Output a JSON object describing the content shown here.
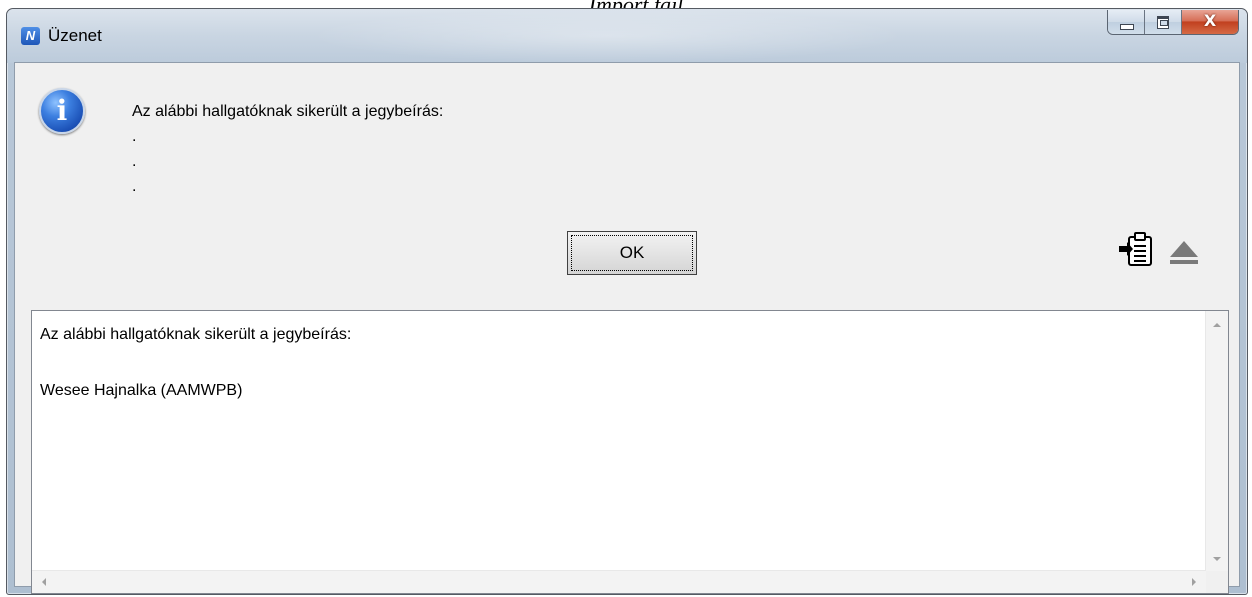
{
  "page_caption": "Import fájl",
  "window": {
    "title": "Üzenet",
    "app_icon_letter": "N",
    "close_glyph": "X"
  },
  "message": {
    "icon_letter": "i",
    "lines": [
      "Az alábbi hallgatóknak sikerült a jegybeírás:",
      ".",
      ".",
      "."
    ]
  },
  "ok_button": {
    "label": "OK"
  },
  "icons": {
    "copy": "clipboard-icon",
    "toggle": "eject-icon"
  },
  "details": {
    "text": "Az alábbi hallgatóknak sikerült a jegybeírás:\n\nWesee Hajnalka (AAMWPB)"
  },
  "colors": {
    "close_button": "#c8452a",
    "info_icon": "#2a64c8"
  }
}
